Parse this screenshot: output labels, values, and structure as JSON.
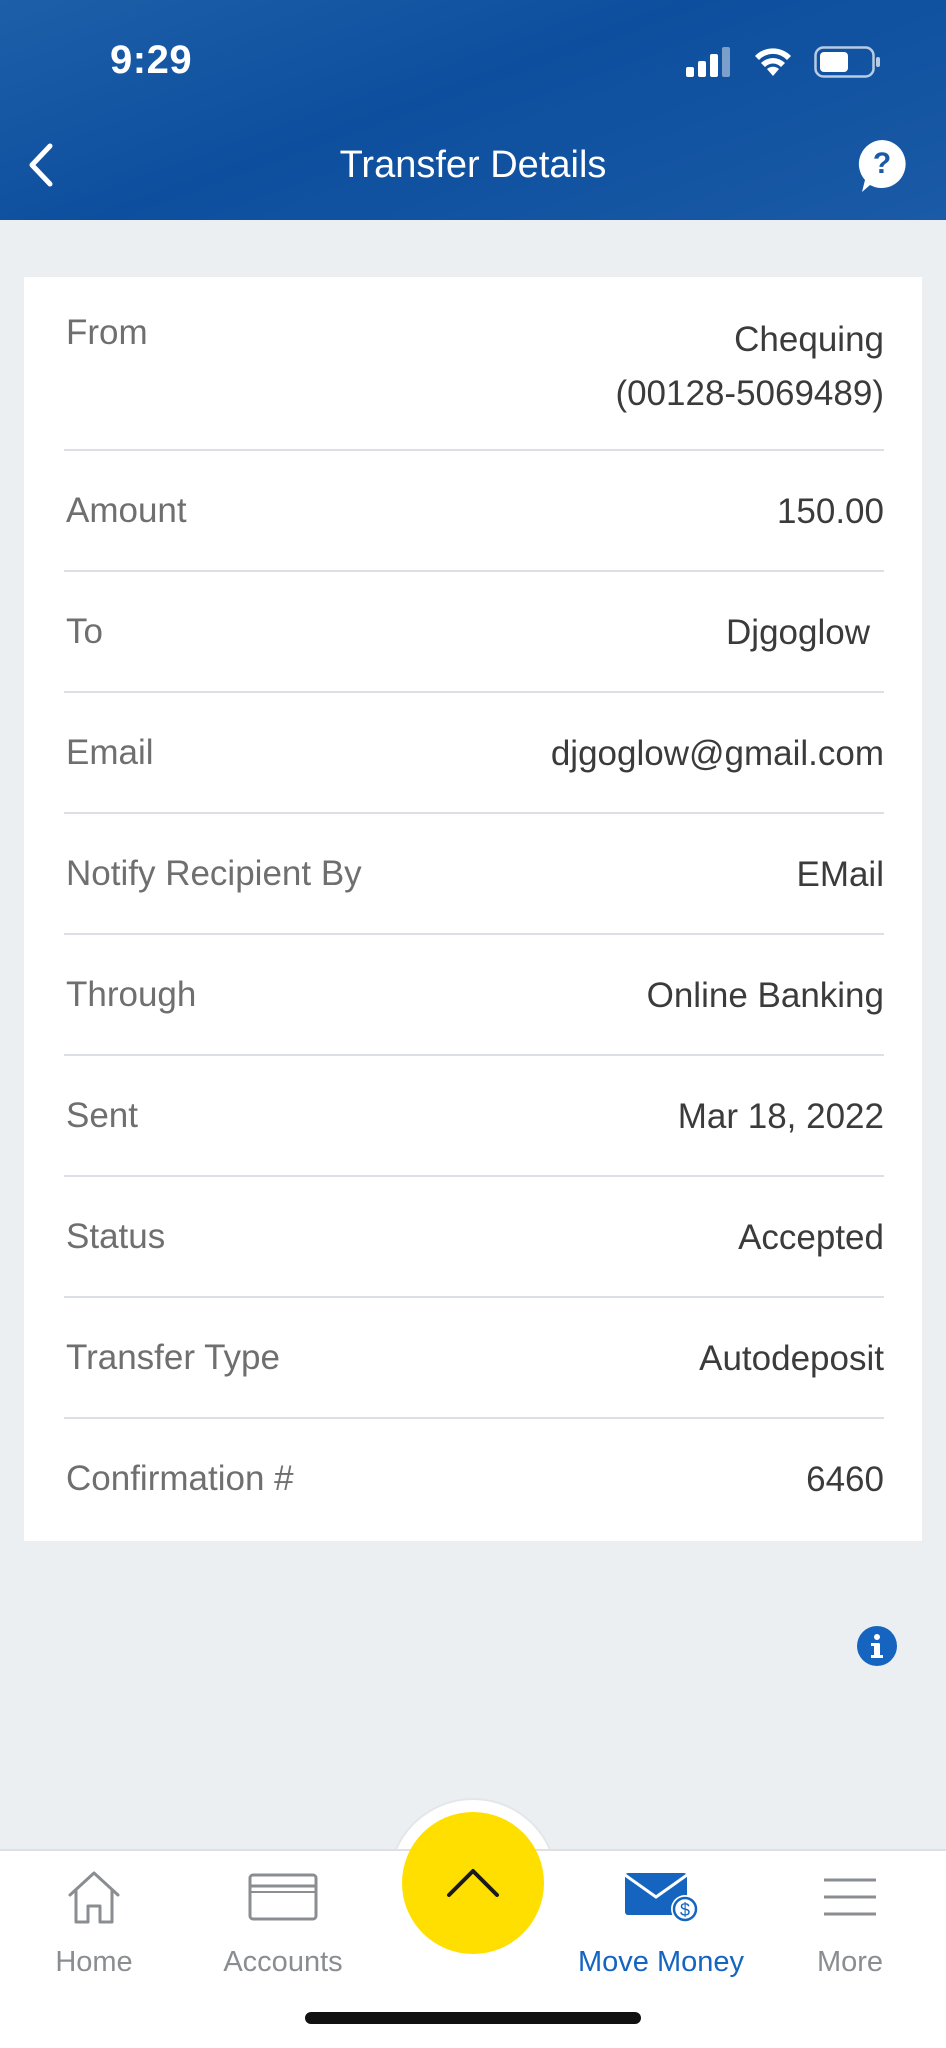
{
  "status_bar": {
    "time": "9:29"
  },
  "header": {
    "title": "Transfer Details",
    "back_icon": "chevron-left-icon",
    "help_icon": "help-bubble-icon"
  },
  "details": {
    "from_label": "From",
    "from_line1": "Chequing",
    "from_line2": "(00128-5069489)",
    "rows": [
      {
        "label": "Amount",
        "value": "150.00"
      },
      {
        "label": "To",
        "value": "Djgoglow"
      },
      {
        "label": "Email",
        "value": "djgoglow@gmail.com"
      },
      {
        "label": "Notify Recipient By",
        "value": "EMail"
      },
      {
        "label": "Through",
        "value": "Online Banking"
      },
      {
        "label": "Sent",
        "value": "Mar 18, 2022"
      },
      {
        "label": "Status",
        "value": "Accepted"
      },
      {
        "label": "Transfer Type",
        "value": "Autodeposit"
      },
      {
        "label": "Confirmation #",
        "value": "6460"
      }
    ]
  },
  "tabs": [
    {
      "label": "Home",
      "icon": "home-icon"
    },
    {
      "label": "Accounts",
      "icon": "card-icon"
    },
    {
      "label": "Move Money",
      "icon": "envelope-dollar-icon",
      "active": true
    },
    {
      "label": "More",
      "icon": "menu-icon"
    }
  ],
  "colors": {
    "header": "#0d4f9e",
    "accent": "#1565c0",
    "fab": "#FFDF00",
    "background": "#ECEFF2"
  }
}
